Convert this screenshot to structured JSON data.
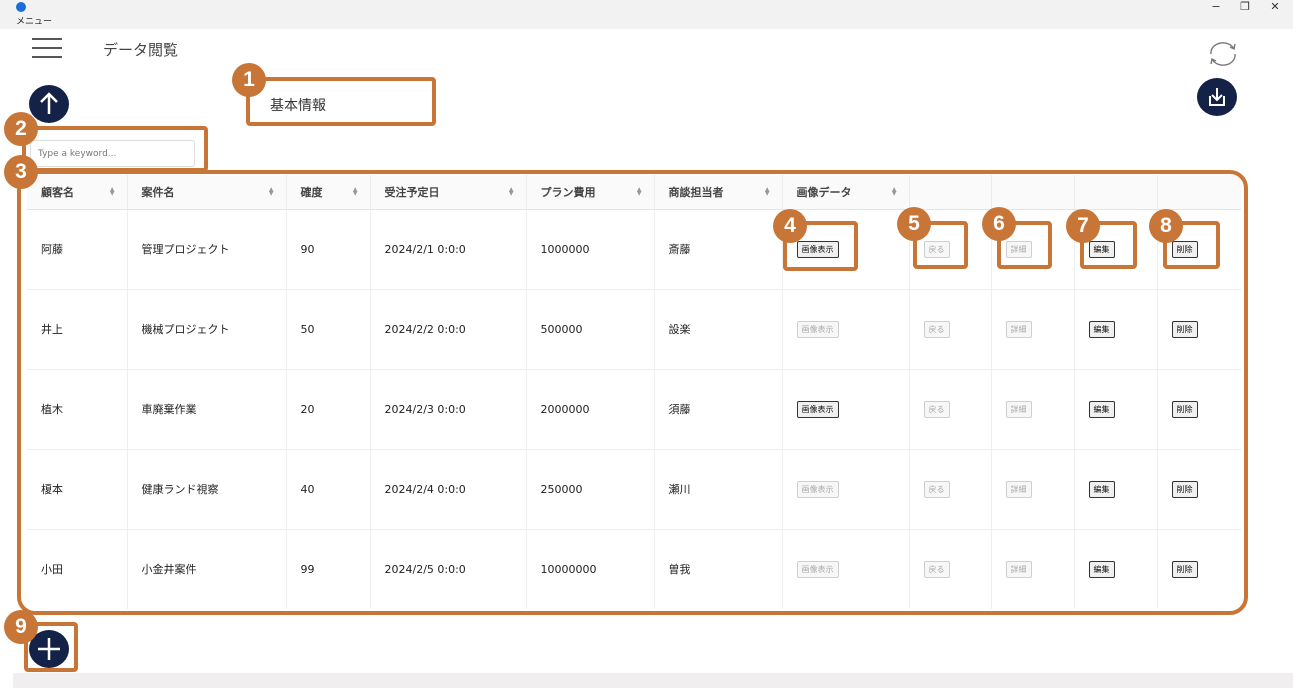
{
  "titlebar": {
    "menu_label": "メニュー",
    "minimize": "−",
    "maximize": "❐",
    "close": "✕"
  },
  "header": {
    "page_title": "データ閲覧",
    "section_label": "基本情報"
  },
  "search": {
    "placeholder": "Type a keyword..."
  },
  "table": {
    "headers": [
      "顧客名",
      "案件名",
      "確度",
      "受注予定日",
      "プラン費用",
      "商談担当者",
      "画像データ",
      "",
      "",
      "",
      ""
    ],
    "rows": [
      {
        "customer": "阿藤",
        "project": "管理プロジェクト",
        "probability": "90",
        "date": "2024/2/1 0:0:0",
        "cost": "1000000",
        "rep": "斎藤",
        "image_enabled": true
      },
      {
        "customer": "井上",
        "project": "機械プロジェクト",
        "probability": "50",
        "date": "2024/2/2 0:0:0",
        "cost": "500000",
        "rep": "設楽",
        "image_enabled": false
      },
      {
        "customer": "植木",
        "project": "車廃棄作業",
        "probability": "20",
        "date": "2024/2/3 0:0:0",
        "cost": "2000000",
        "rep": "須藤",
        "image_enabled": true
      },
      {
        "customer": "榎本",
        "project": "健康ランド視察",
        "probability": "40",
        "date": "2024/2/4 0:0:0",
        "cost": "250000",
        "rep": "瀬川",
        "image_enabled": false
      },
      {
        "customer": "小田",
        "project": "小金井案件",
        "probability": "99",
        "date": "2024/2/5 0:0:0",
        "cost": "10000000",
        "rep": "曽我",
        "image_enabled": false
      }
    ],
    "buttons": {
      "image": "画像表示",
      "back": "戻る",
      "detail": "詳細",
      "edit": "編集",
      "delete": "削除"
    }
  },
  "callouts": [
    "1",
    "2",
    "3",
    "4",
    "5",
    "6",
    "7",
    "8",
    "9"
  ],
  "colors": {
    "accent": "#c87637",
    "navy": "#142248"
  },
  "icons": {
    "menu": "hamburger-icon",
    "refresh": "refresh-icon",
    "export": "download-icon",
    "upload": "arrow-up-icon",
    "add": "plus-icon",
    "sort": "sort-icon"
  }
}
